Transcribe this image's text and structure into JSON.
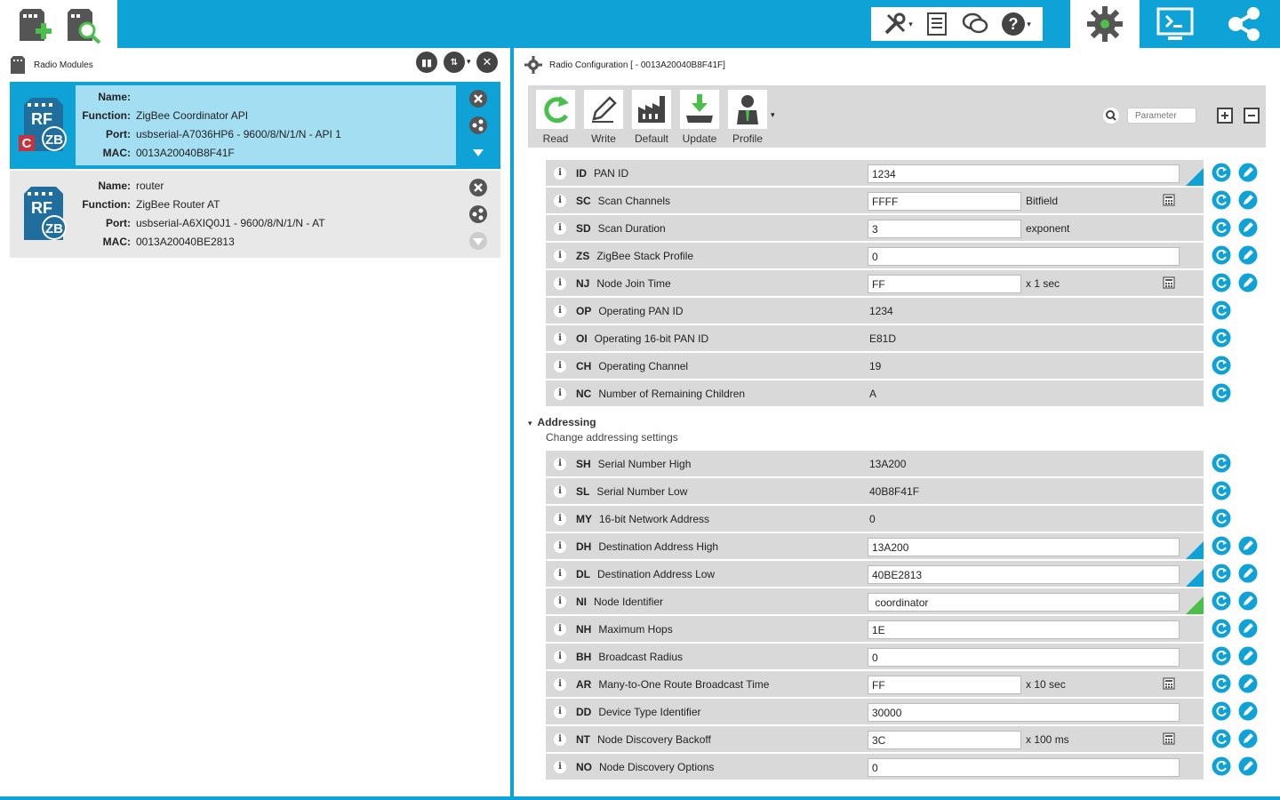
{
  "left_panel": {
    "title": "Radio Modules",
    "modules": [
      {
        "name_label": "Name:",
        "name": "",
        "function_label": "Function:",
        "function": "ZigBee Coordinator API",
        "port_label": "Port:",
        "port": "usbserial-A7036HP6 - 9600/8/N/1/N - API 1",
        "mac_label": "MAC:",
        "mac": "0013A20040B8F41F",
        "badge": "C",
        "icon_text_top": "RF",
        "icon_text_bottom": "ZB"
      },
      {
        "name_label": "Name:",
        "name": "router",
        "function_label": "Function:",
        "function": "ZigBee Router AT",
        "port_label": "Port:",
        "port": "usbserial-A6XIQ0J1 - 9600/8/N/1/N - AT",
        "mac_label": "MAC:",
        "mac": "0013A20040BE2813",
        "icon_text_top": "RF",
        "icon_text_bottom": "ZB"
      }
    ]
  },
  "right_panel": {
    "title": "Radio Configuration [  - 0013A20040B8F41F]",
    "ribbon": {
      "read": "Read",
      "write": "Write",
      "default": "Default",
      "update": "Update",
      "profile": "Profile"
    },
    "search_placeholder": "Parameter",
    "section": {
      "title": "Addressing",
      "description": "Change addressing settings"
    },
    "params_top": [
      {
        "code": "ID",
        "name": "PAN ID",
        "value": "1234",
        "kind": "long",
        "write": true,
        "corner": "blue"
      },
      {
        "code": "SC",
        "name": "Scan Channels",
        "value": "FFFF",
        "kind": "short",
        "unit": "Bitfield",
        "calc": true,
        "write": true
      },
      {
        "code": "SD",
        "name": "Scan Duration",
        "value": "3",
        "kind": "short",
        "unit": "exponent",
        "write": true
      },
      {
        "code": "ZS",
        "name": "ZigBee Stack Profile",
        "value": "0",
        "kind": "long",
        "write": true
      },
      {
        "code": "NJ",
        "name": "Node Join Time",
        "value": "FF",
        "kind": "short",
        "unit": "x 1 sec",
        "calc": true,
        "write": true
      },
      {
        "code": "OP",
        "name": "Operating PAN ID",
        "value": "1234",
        "kind": "ro"
      },
      {
        "code": "OI",
        "name": "Operating 16-bit PAN ID",
        "value": "E81D",
        "kind": "ro"
      },
      {
        "code": "CH",
        "name": "Operating Channel",
        "value": "19",
        "kind": "ro"
      },
      {
        "code": "NC",
        "name": "Number of Remaining Children",
        "value": "A",
        "kind": "ro"
      }
    ],
    "params_addr": [
      {
        "code": "SH",
        "name": "Serial Number High",
        "value": "13A200",
        "kind": "ro"
      },
      {
        "code": "SL",
        "name": "Serial Number Low",
        "value": "40B8F41F",
        "kind": "ro"
      },
      {
        "code": "MY",
        "name": "16-bit Network Address",
        "value": "0",
        "kind": "ro"
      },
      {
        "code": "DH",
        "name": "Destination Address High",
        "value": "13A200",
        "kind": "long",
        "write": true,
        "corner": "blue"
      },
      {
        "code": "DL",
        "name": "Destination Address Low",
        "value": "40BE2813",
        "kind": "long",
        "write": true,
        "corner": "blue"
      },
      {
        "code": "NI",
        "name": "Node Identifier",
        "value": " coordinator",
        "kind": "long",
        "write": true,
        "corner": "green"
      },
      {
        "code": "NH",
        "name": "Maximum Hops",
        "value": "1E",
        "kind": "long",
        "write": true
      },
      {
        "code": "BH",
        "name": "Broadcast Radius",
        "value": "0",
        "kind": "long",
        "write": true
      },
      {
        "code": "AR",
        "name": "Many-to-One Route Broadcast Time",
        "value": "FF",
        "kind": "short",
        "unit": "x 10 sec",
        "calc": true,
        "write": true
      },
      {
        "code": "DD",
        "name": "Device Type Identifier",
        "value": "30000",
        "kind": "long",
        "write": true
      },
      {
        "code": "NT",
        "name": "Node Discovery Backoff",
        "value": "3C",
        "kind": "short",
        "unit": "x 100 ms",
        "calc": true,
        "write": true
      },
      {
        "code": "NO",
        "name": "Node Discovery Options",
        "value": "0",
        "kind": "long",
        "write": true
      }
    ]
  },
  "colors": {
    "accent": "#0ea2d6",
    "selected_module": "#a4def2",
    "row_bg": "#d9d9d9",
    "green": "#4bbf4b",
    "badge_red": "#c8323c"
  }
}
